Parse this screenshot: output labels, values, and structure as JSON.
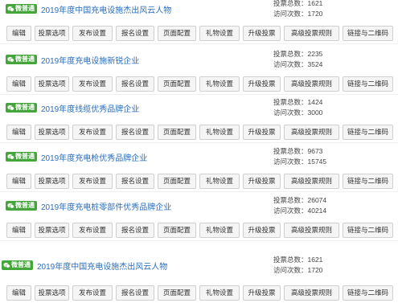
{
  "badge_label": "微普通",
  "colors": {
    "badge": "#44a63a",
    "title": "#2a6ebb",
    "button_border": "#cfcfcf"
  },
  "stat_labels": {
    "votes": "投票总数：",
    "visits": "访问次数："
  },
  "buttons": [
    "编辑",
    "投票选项",
    "发布设置",
    "报名设置",
    "页面配置",
    "礼物设置",
    "升级投票",
    "高级投票规则",
    "链接与二维码"
  ],
  "votes": [
    {
      "title": "2019年度中国充电设施杰出风云人物",
      "votes": "1621",
      "visits": "1720"
    },
    {
      "title": "2019年度充电设施新锐企业",
      "votes": "2235",
      "visits": "3524"
    },
    {
      "title": "2019年度线缆优秀品牌企业",
      "votes": "1424",
      "visits": "3000"
    },
    {
      "title": "2019年度充电枪优秀品牌企业",
      "votes": "9673",
      "visits": "15745"
    },
    {
      "title": "2019年度充电桩零部件优秀品牌企业",
      "votes": "26074",
      "visits": "40214"
    },
    {
      "title": "2019年度中国充电设施杰出风云人物",
      "votes": "1621",
      "visits": "1720"
    }
  ]
}
